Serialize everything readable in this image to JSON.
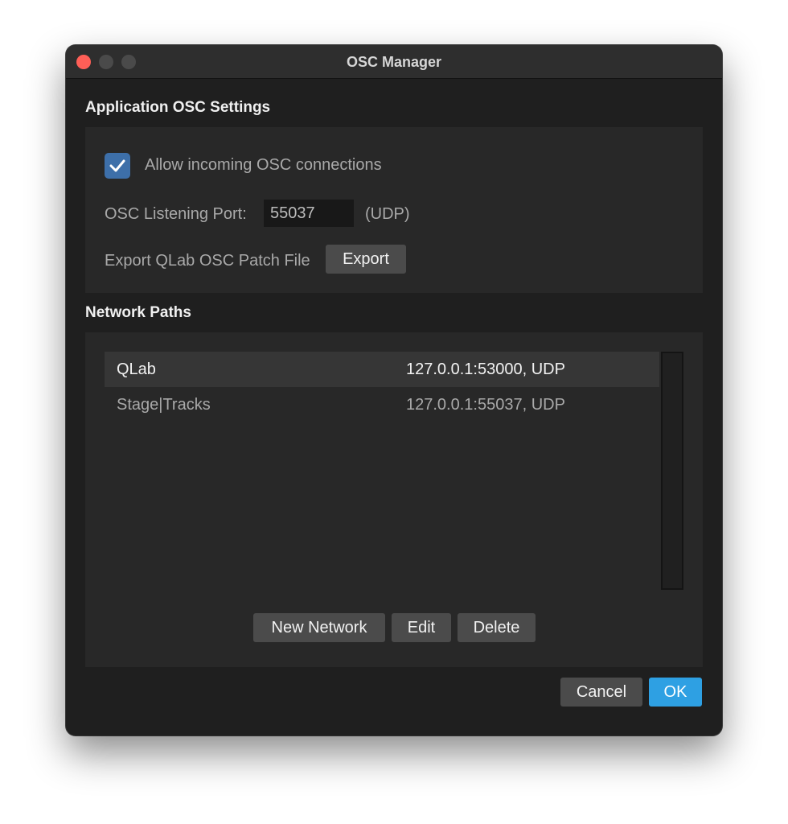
{
  "window": {
    "title": "OSC Manager"
  },
  "app_settings": {
    "heading": "Application OSC Settings",
    "allow_incoming": {
      "checked": true,
      "label": "Allow incoming OSC connections"
    },
    "listening_port": {
      "label": "OSC Listening Port:",
      "value": "55037",
      "protocol": "(UDP)"
    },
    "export_patch": {
      "label": "Export QLab OSC Patch File",
      "button_label": "Export"
    }
  },
  "network_paths": {
    "heading": "Network Paths",
    "rows": [
      {
        "name": "QLab",
        "address": "127.0.0.1:53000, UDP",
        "selected": true
      },
      {
        "name": "Stage|Tracks",
        "address": "127.0.0.1:55037, UDP",
        "selected": false
      }
    ],
    "buttons": {
      "new_label": "New Network",
      "edit_label": "Edit",
      "delete_label": "Delete"
    }
  },
  "footer": {
    "cancel_label": "Cancel",
    "ok_label": "OK"
  },
  "colors": {
    "accent": "#2ea0e3",
    "checkbox": "#3d6fa9",
    "close_button": "#ff5f57"
  },
  "icons": {
    "check": "check-icon"
  }
}
